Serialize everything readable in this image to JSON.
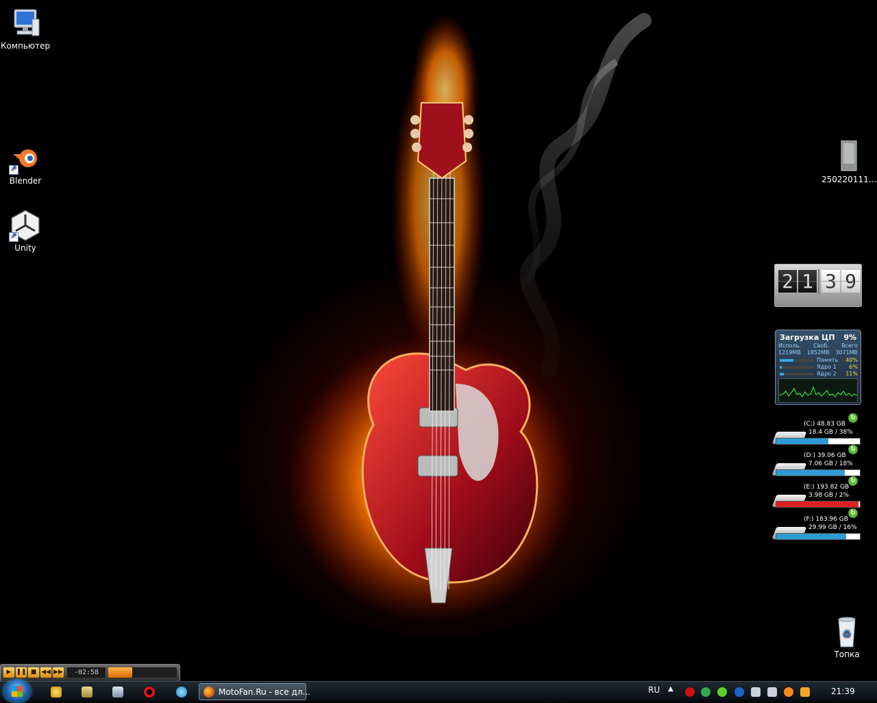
{
  "desktop": {
    "icons": [
      {
        "label": "Компьютер"
      },
      {
        "label": "Blender"
      },
      {
        "label": "Unity"
      },
      {
        "label": "250220111..."
      },
      {
        "label": "Топка"
      }
    ]
  },
  "clock_gadget": {
    "h1": "2",
    "h2": "1",
    "m1": "3",
    "m2": "9"
  },
  "cpu_gadget": {
    "title": "Загрузка ЦП",
    "cpu_percent": "9%",
    "headers": [
      "Исполь.",
      "Своб.",
      "Всего"
    ],
    "values": [
      "1219MB",
      "1852MB",
      "3071MB"
    ],
    "rows": [
      {
        "label": "Память",
        "value": "40%",
        "level": 0.4
      },
      {
        "label": "Ядро 1",
        "value": "6%",
        "level": 0.06
      },
      {
        "label": "Ядро 2",
        "value": "11%",
        "level": 0.11
      }
    ]
  },
  "drives": [
    {
      "name": "(C:) 48.83 GB",
      "usage": "18.4 GB / 38%",
      "free_fraction": 0.62,
      "color": "#2f9bd6"
    },
    {
      "name": "(D:) 39.06 GB",
      "usage": "7.06 GB / 18%",
      "free_fraction": 0.82,
      "color": "#2f9bd6"
    },
    {
      "name": "(E:) 193.82 GB",
      "usage": "3.98 GB / 2%",
      "free_fraction": 0.98,
      "color": "#e02020"
    },
    {
      "name": "(F:) 183.96 GB",
      "usage": "29.99 GB / 16%",
      "free_fraction": 0.84,
      "color": "#2f9bd6"
    }
  ],
  "player": {
    "time": "-02:58",
    "volume": 0.35
  },
  "taskbar": {
    "task_label": "MotoFan.Ru - все дл...",
    "language": "RU",
    "tray_up": "▲",
    "clock": "21:39"
  }
}
